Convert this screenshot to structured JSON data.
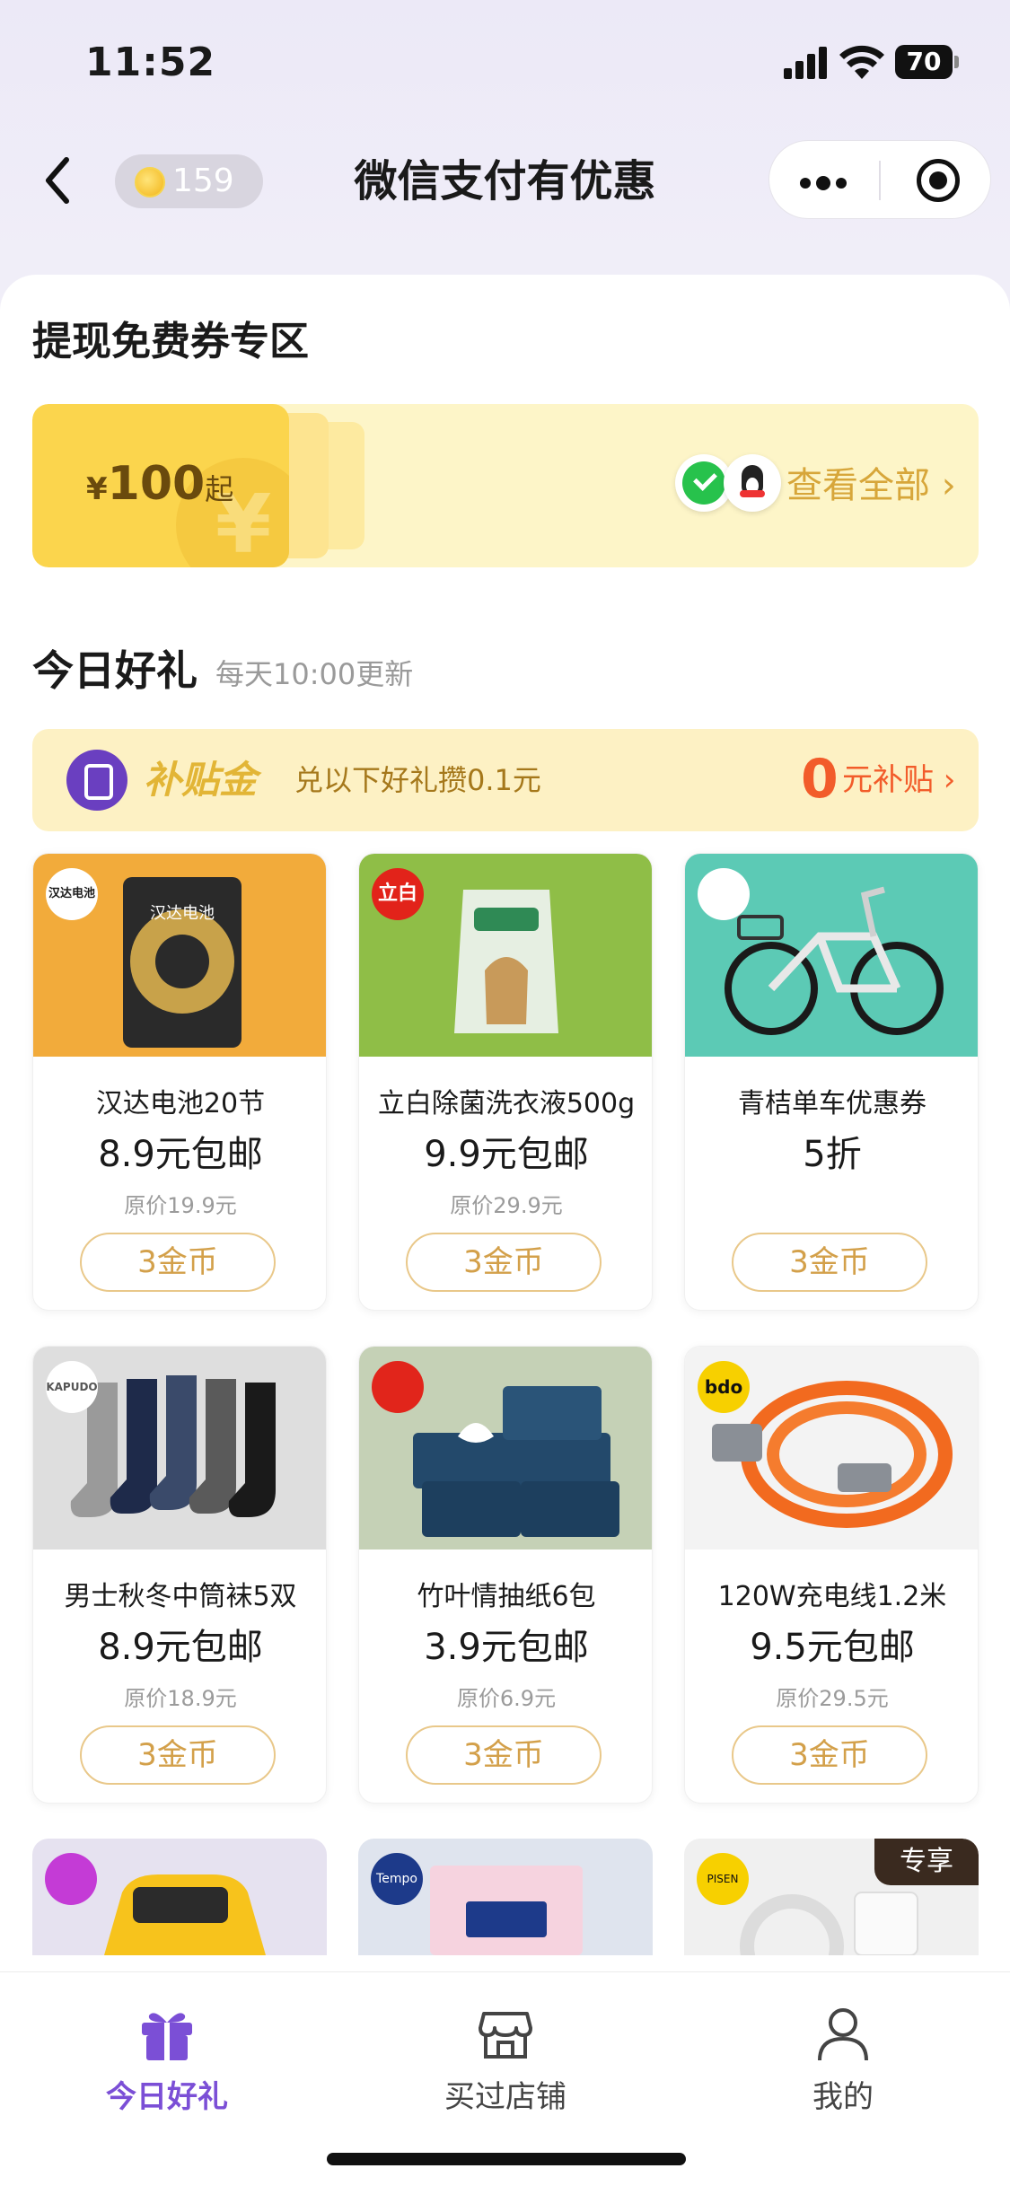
{
  "status": {
    "time": "11:52",
    "battery": "70"
  },
  "nav": {
    "coins": "159",
    "title": "微信支付有优惠"
  },
  "section1": {
    "title": "提现免费券专区",
    "coupon_currency": "¥",
    "coupon_amount": "100",
    "coupon_suffix": "起",
    "coupon_watermark": "¥",
    "view_all": "查看全部 ›"
  },
  "section2": {
    "title": "今日好礼",
    "subtitle": "每天10:00更新",
    "subsidy_label": "补贴金",
    "subsidy_desc": "兑以下好礼攒0.1元",
    "subsidy_amount": "0",
    "subsidy_unit": "元补贴 ›"
  },
  "products": [
    {
      "name": "汉达电池20节",
      "price": "8.9元包邮",
      "orig": "原价19.9元",
      "btn": "3金币",
      "logo": "汉达电池"
    },
    {
      "name": "立白除菌洗衣液500g",
      "price": "9.9元包邮",
      "orig": "原价29.9元",
      "btn": "3金币",
      "logo": "立白"
    },
    {
      "name": "青桔单车优惠券",
      "price": "5折",
      "orig": "",
      "btn": "3金币",
      "logo": ""
    },
    {
      "name": "男士秋冬中筒袜5双",
      "price": "8.9元包邮",
      "orig": "原价18.9元",
      "btn": "3金币",
      "logo": "KAPUDO"
    },
    {
      "name": "竹叶情抽纸6包",
      "price": "3.9元包邮",
      "orig": "原价6.9元",
      "btn": "3金币",
      "logo": ""
    },
    {
      "name": "120W充电线1.2米",
      "price": "9.5元包邮",
      "orig": "原价29.5元",
      "btn": "3金币",
      "logo": "bdo"
    }
  ],
  "partial": [
    {
      "logo": ""
    },
    {
      "logo": "Tempo",
      "brand": "Tempo"
    },
    {
      "logo": "PISEN",
      "tag": "专享"
    }
  ],
  "tabs": [
    {
      "label": "今日好礼",
      "icon": "gift-icon",
      "active": true
    },
    {
      "label": "买过店铺",
      "icon": "store-icon",
      "active": false
    },
    {
      "label": "我的",
      "icon": "user-icon",
      "active": false
    }
  ],
  "colors": {
    "accent": "#7b4fd6",
    "gold": "#d3a04a",
    "red": "#f25c2a"
  }
}
